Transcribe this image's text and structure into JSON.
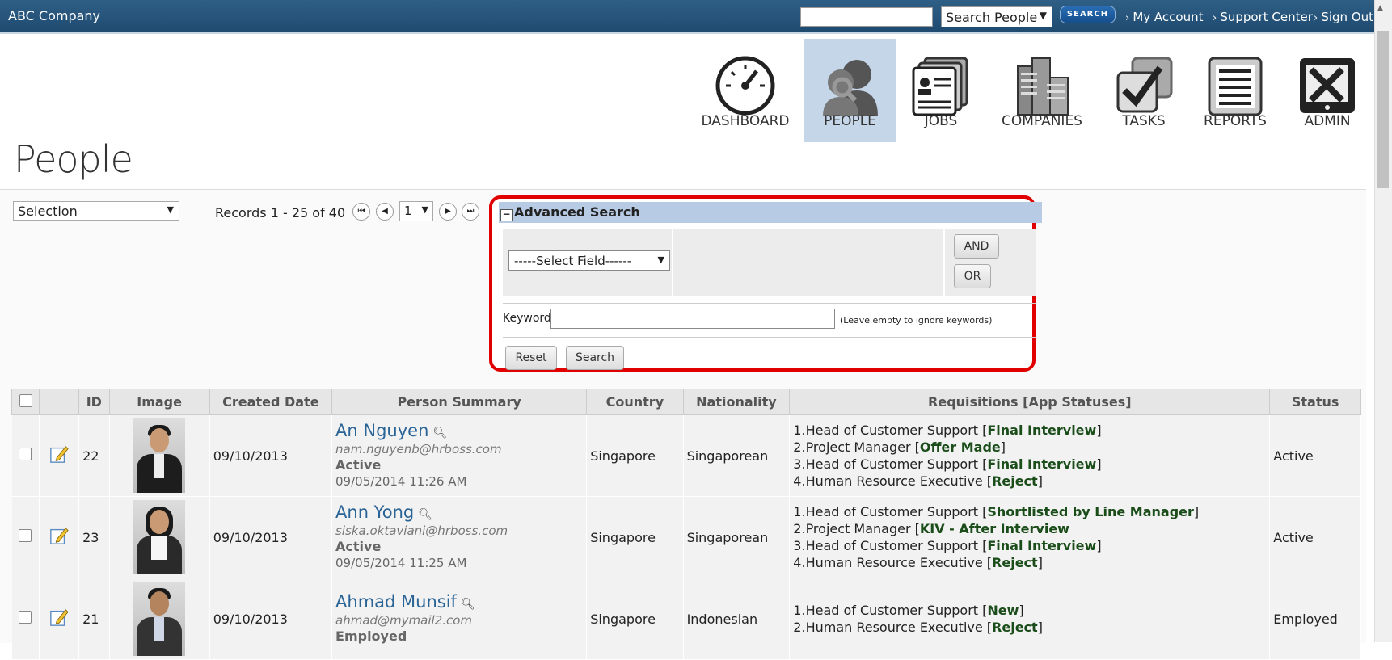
{
  "header": {
    "brand": "ABC Company",
    "search_people": "Search People",
    "search_button": "SEARCH",
    "links": [
      "My Account",
      "Support Center",
      "Sign Out"
    ]
  },
  "modules": [
    {
      "label": "DASHBOARD",
      "icon": "gauge-icon",
      "active": false
    },
    {
      "label": "PEOPLE",
      "icon": "people-icon",
      "active": true
    },
    {
      "label": "JOBS",
      "icon": "jobs-icon",
      "active": false
    },
    {
      "label": "COMPANIES",
      "icon": "companies-icon",
      "active": false
    },
    {
      "label": "TASKS",
      "icon": "tasks-icon",
      "active": false
    },
    {
      "label": "REPORTS",
      "icon": "reports-icon",
      "active": false
    },
    {
      "label": "ADMIN",
      "icon": "admin-icon",
      "active": false
    }
  ],
  "page": {
    "title": "People"
  },
  "toolbar": {
    "selection": "Selection",
    "records": "Records 1 - 25 of 40",
    "page": "1"
  },
  "advanced_search": {
    "title": "Advanced Search",
    "field_select": "-----Select Field------",
    "and": "AND",
    "or": "OR",
    "keyword_label": "Keyword:",
    "keyword_hint": "(Leave empty to ignore keywords)",
    "reset": "Reset",
    "search": "Search"
  },
  "table": {
    "headers": [
      "ID",
      "Image",
      "Created Date",
      "Person Summary",
      "Country",
      "Nationality",
      "Requisitions [App Statuses]",
      "Status"
    ],
    "rows": [
      {
        "id": "22",
        "created": "09/10/2013",
        "name": "An Nguyen",
        "email": "nam.nguyenb@hrboss.com",
        "pstatus": "Active",
        "pdate": "09/05/2014 11:26 AM",
        "country": "Singapore",
        "nationality": "Singaporean",
        "reqs": [
          {
            "text": "1.Head of Customer Support [",
            "status": "Final Interview"
          },
          {
            "text": "2.Project Manager [",
            "status": "Offer Made"
          },
          {
            "text": "3.Head of Customer Support [",
            "status": "Final Interview"
          },
          {
            "text": "4.Human Resource Executive [",
            "status": "Reject"
          }
        ],
        "status": "Active"
      },
      {
        "id": "23",
        "created": "09/10/2013",
        "name": "Ann Yong",
        "email": "siska.oktaviani@hrboss.com",
        "pstatus": "Active",
        "pdate": "09/05/2014 11:25 AM",
        "country": "Singapore",
        "nationality": "Singaporean",
        "reqs": [
          {
            "text": "1.Head of Customer Support [",
            "status": "Shortlisted by Line Manager"
          },
          {
            "text": "2.Project Manager [",
            "status": "KIV - After Interview"
          },
          {
            "text": "3.Head of Customer Support [",
            "status": "Final Interview"
          },
          {
            "text": "4.Human Resource Executive [",
            "status": "Reject"
          }
        ],
        "status": "Active"
      },
      {
        "id": "21",
        "created": "09/10/2013",
        "name": "Ahmad Munsif",
        "email": "ahmad@mymail2.com",
        "pstatus": "Employed",
        "pdate": "",
        "country": "Singapore",
        "nationality": "Indonesian",
        "reqs": [
          {
            "text": "1.Head of Customer Support [",
            "status": "New"
          },
          {
            "text": "2.Human Resource Executive [",
            "status": "Reject"
          }
        ],
        "status": "Employed"
      }
    ]
  }
}
